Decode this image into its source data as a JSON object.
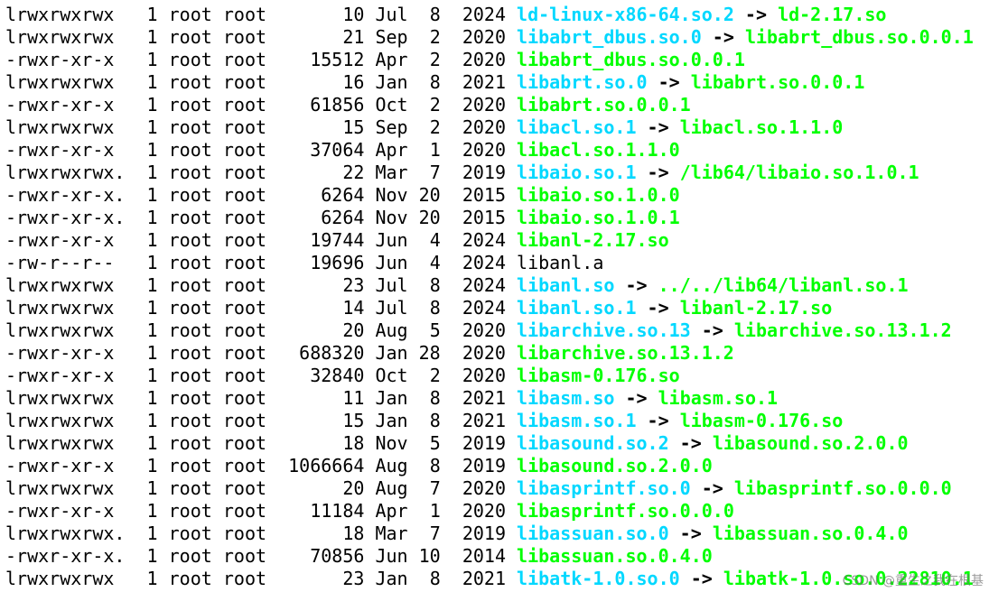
{
  "terminal": {
    "rows": [
      {
        "perm": "lrwxrwxrwx",
        "links": "1",
        "owner": "root",
        "group": "root",
        "size": "10",
        "month": "Jul",
        "day": "8",
        "year": "2024",
        "name": "ld-linux-x86-64.so.2",
        "kind": "link",
        "target": "ld-2.17.so"
      },
      {
        "perm": "lrwxrwxrwx",
        "links": "1",
        "owner": "root",
        "group": "root",
        "size": "21",
        "month": "Sep",
        "day": "2",
        "year": "2020",
        "name": "libabrt_dbus.so.0",
        "kind": "link",
        "target": "libabrt_dbus.so.0.0.1"
      },
      {
        "perm": "-rwxr-xr-x",
        "links": "1",
        "owner": "root",
        "group": "root",
        "size": "15512",
        "month": "Apr",
        "day": "2",
        "year": "2020",
        "name": "libabrt_dbus.so.0.0.1",
        "kind": "exe",
        "target": ""
      },
      {
        "perm": "lrwxrwxrwx",
        "links": "1",
        "owner": "root",
        "group": "root",
        "size": "16",
        "month": "Jan",
        "day": "8",
        "year": "2021",
        "name": "libabrt.so.0",
        "kind": "link",
        "target": "libabrt.so.0.0.1"
      },
      {
        "perm": "-rwxr-xr-x",
        "links": "1",
        "owner": "root",
        "group": "root",
        "size": "61856",
        "month": "Oct",
        "day": "2",
        "year": "2020",
        "name": "libabrt.so.0.0.1",
        "kind": "exe",
        "target": ""
      },
      {
        "perm": "lrwxrwxrwx",
        "links": "1",
        "owner": "root",
        "group": "root",
        "size": "15",
        "month": "Sep",
        "day": "2",
        "year": "2020",
        "name": "libacl.so.1",
        "kind": "link",
        "target": "libacl.so.1.1.0"
      },
      {
        "perm": "-rwxr-xr-x",
        "links": "1",
        "owner": "root",
        "group": "root",
        "size": "37064",
        "month": "Apr",
        "day": "1",
        "year": "2020",
        "name": "libacl.so.1.1.0",
        "kind": "exe",
        "target": ""
      },
      {
        "perm": "lrwxrwxrwx.",
        "links": "1",
        "owner": "root",
        "group": "root",
        "size": "22",
        "month": "Mar",
        "day": "7",
        "year": "2019",
        "name": "libaio.so.1",
        "kind": "link",
        "target": "/lib64/libaio.so.1.0.1"
      },
      {
        "perm": "-rwxr-xr-x.",
        "links": "1",
        "owner": "root",
        "group": "root",
        "size": "6264",
        "month": "Nov",
        "day": "20",
        "year": "2015",
        "name": "libaio.so.1.0.0",
        "kind": "exe",
        "target": ""
      },
      {
        "perm": "-rwxr-xr-x.",
        "links": "1",
        "owner": "root",
        "group": "root",
        "size": "6264",
        "month": "Nov",
        "day": "20",
        "year": "2015",
        "name": "libaio.so.1.0.1",
        "kind": "exe",
        "target": ""
      },
      {
        "perm": "-rwxr-xr-x",
        "links": "1",
        "owner": "root",
        "group": "root",
        "size": "19744",
        "month": "Jun",
        "day": "4",
        "year": "2024",
        "name": "libanl-2.17.so",
        "kind": "exe",
        "target": ""
      },
      {
        "perm": "-rw-r--r--",
        "links": "1",
        "owner": "root",
        "group": "root",
        "size": "19696",
        "month": "Jun",
        "day": "4",
        "year": "2024",
        "name": "libanl.a",
        "kind": "plain",
        "target": ""
      },
      {
        "perm": "lrwxrwxrwx",
        "links": "1",
        "owner": "root",
        "group": "root",
        "size": "23",
        "month": "Jul",
        "day": "8",
        "year": "2024",
        "name": "libanl.so",
        "kind": "link",
        "target": "../../lib64/libanl.so.1"
      },
      {
        "perm": "lrwxrwxrwx",
        "links": "1",
        "owner": "root",
        "group": "root",
        "size": "14",
        "month": "Jul",
        "day": "8",
        "year": "2024",
        "name": "libanl.so.1",
        "kind": "link",
        "target": "libanl-2.17.so"
      },
      {
        "perm": "lrwxrwxrwx",
        "links": "1",
        "owner": "root",
        "group": "root",
        "size": "20",
        "month": "Aug",
        "day": "5",
        "year": "2020",
        "name": "libarchive.so.13",
        "kind": "link",
        "target": "libarchive.so.13.1.2"
      },
      {
        "perm": "-rwxr-xr-x",
        "links": "1",
        "owner": "root",
        "group": "root",
        "size": "688320",
        "month": "Jan",
        "day": "28",
        "year": "2020",
        "name": "libarchive.so.13.1.2",
        "kind": "exe",
        "target": ""
      },
      {
        "perm": "-rwxr-xr-x",
        "links": "1",
        "owner": "root",
        "group": "root",
        "size": "32840",
        "month": "Oct",
        "day": "2",
        "year": "2020",
        "name": "libasm-0.176.so",
        "kind": "exe",
        "target": ""
      },
      {
        "perm": "lrwxrwxrwx",
        "links": "1",
        "owner": "root",
        "group": "root",
        "size": "11",
        "month": "Jan",
        "day": "8",
        "year": "2021",
        "name": "libasm.so",
        "kind": "link",
        "target": "libasm.so.1"
      },
      {
        "perm": "lrwxrwxrwx",
        "links": "1",
        "owner": "root",
        "group": "root",
        "size": "15",
        "month": "Jan",
        "day": "8",
        "year": "2021",
        "name": "libasm.so.1",
        "kind": "link",
        "target": "libasm-0.176.so"
      },
      {
        "perm": "lrwxrwxrwx",
        "links": "1",
        "owner": "root",
        "group": "root",
        "size": "18",
        "month": "Nov",
        "day": "5",
        "year": "2019",
        "name": "libasound.so.2",
        "kind": "link",
        "target": "libasound.so.2.0.0"
      },
      {
        "perm": "-rwxr-xr-x",
        "links": "1",
        "owner": "root",
        "group": "root",
        "size": "1066664",
        "month": "Aug",
        "day": "8",
        "year": "2019",
        "name": "libasound.so.2.0.0",
        "kind": "exe",
        "target": ""
      },
      {
        "perm": "lrwxrwxrwx",
        "links": "1",
        "owner": "root",
        "group": "root",
        "size": "20",
        "month": "Aug",
        "day": "7",
        "year": "2020",
        "name": "libasprintf.so.0",
        "kind": "link",
        "target": "libasprintf.so.0.0.0"
      },
      {
        "perm": "-rwxr-xr-x",
        "links": "1",
        "owner": "root",
        "group": "root",
        "size": "11184",
        "month": "Apr",
        "day": "1",
        "year": "2020",
        "name": "libasprintf.so.0.0.0",
        "kind": "exe",
        "target": ""
      },
      {
        "perm": "lrwxrwxrwx.",
        "links": "1",
        "owner": "root",
        "group": "root",
        "size": "18",
        "month": "Mar",
        "day": "7",
        "year": "2019",
        "name": "libassuan.so.0",
        "kind": "link",
        "target": "libassuan.so.0.4.0"
      },
      {
        "perm": "-rwxr-xr-x.",
        "links": "1",
        "owner": "root",
        "group": "root",
        "size": "70856",
        "month": "Jun",
        "day": "10",
        "year": "2014",
        "name": "libassuan.so.0.4.0",
        "kind": "exe",
        "target": ""
      },
      {
        "perm": "lrwxrwxrwx",
        "links": "1",
        "owner": "root",
        "group": "root",
        "size": "23",
        "month": "Jan",
        "day": "8",
        "year": "2021",
        "name": "libatk-1.0.so.0",
        "kind": "link",
        "target": "libatk-1.0.so.0.22810.1"
      }
    ],
    "arrow": "->"
  },
  "watermark": "CSDN @重生之我在根基",
  "colors": {
    "background": "#ffffff",
    "text": "#000000",
    "executable": "#00ff00",
    "symlink": "#00d8ff"
  }
}
